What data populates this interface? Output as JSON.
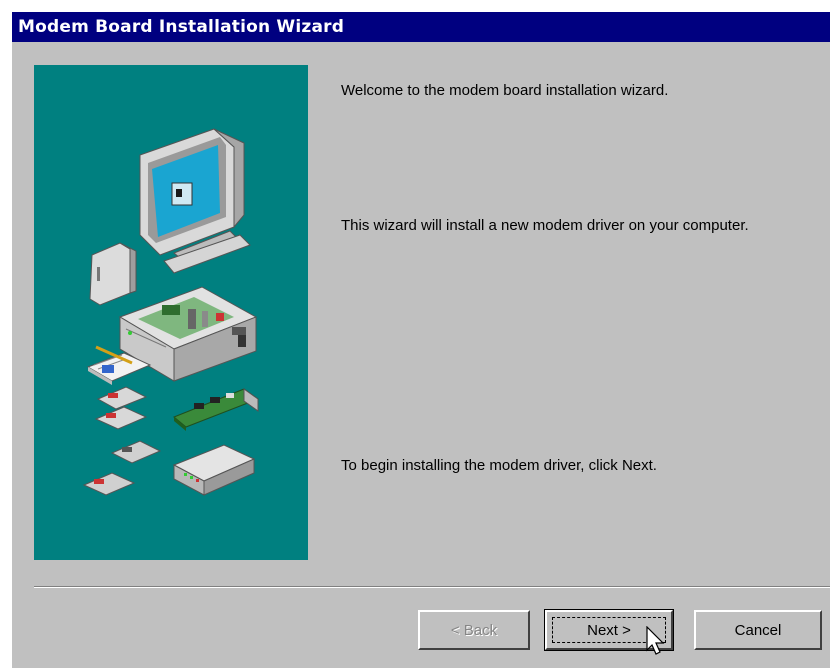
{
  "window": {
    "title": "Modem Board Installation Wizard"
  },
  "content": {
    "welcome": "Welcome to the modem board installation wizard.",
    "description": "This wizard will install a new modem driver on your computer.",
    "instruction": "To begin installing the modem driver, click Next."
  },
  "buttons": {
    "back_label": "< Back",
    "next_label": "Next >",
    "cancel_label": "Cancel"
  },
  "colors": {
    "titlebar": "#000080",
    "dialog_face": "#c0c0c0",
    "art_background": "#008080"
  },
  "illustration": {
    "items": [
      "monitor-icon",
      "external-drive-icon",
      "computer-case-icon",
      "manual-icon",
      "floppy-disk-icon",
      "modem-card-icon",
      "external-modem-icon"
    ]
  }
}
